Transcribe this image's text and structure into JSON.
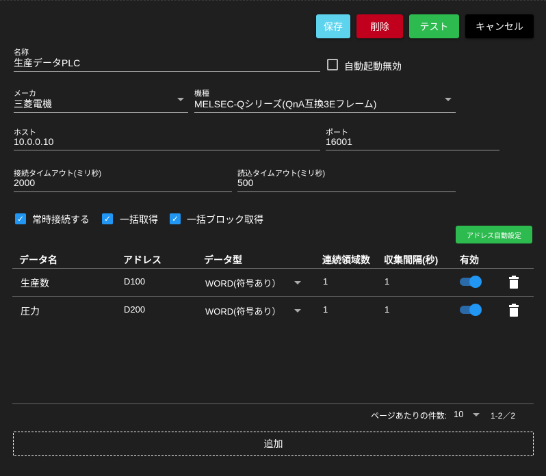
{
  "buttons": {
    "save": "保存",
    "delete": "削除",
    "test": "テスト",
    "cancel": "キャンセル"
  },
  "form": {
    "name": {
      "label": "名称",
      "value": "生産データPLC"
    },
    "auto_start_disabled": {
      "label": "自動起動無効",
      "checked": false
    },
    "maker": {
      "label": "メーカ",
      "value": "三菱電機"
    },
    "model": {
      "label": "機種",
      "value": "MELSEC-Qシリーズ(QnA互換3Eフレーム)"
    },
    "host": {
      "label": "ホスト",
      "value": "10.0.0.10"
    },
    "port": {
      "label": "ポート",
      "value": "16001"
    },
    "connect_timeout": {
      "label": "接続タイムアウト(ミリ秒)",
      "value": "2000"
    },
    "read_timeout": {
      "label": "読込タイムアウト(ミリ秒)",
      "value": "500"
    },
    "options": [
      {
        "label": "常時接続する",
        "checked": true
      },
      {
        "label": "一括取得",
        "checked": true
      },
      {
        "label": "一括ブロック取得",
        "checked": true
      }
    ]
  },
  "auto_address_button": "アドレス自動設定",
  "table": {
    "headers": [
      "データ名",
      "アドレス",
      "データ型",
      "連続領域数",
      "収集間隔(秒)",
      "有効"
    ],
    "rows": [
      {
        "name": "生産数",
        "address": "D100",
        "type": "WORD(符号あり）",
        "count": "1",
        "interval": "1",
        "enabled": true
      },
      {
        "name": "圧力",
        "address": "D200",
        "type": "WORD(符号あり）",
        "count": "1",
        "interval": "1",
        "enabled": true
      }
    ]
  },
  "pagination": {
    "per_page_label": "ページあたりの件数:",
    "per_page": "10",
    "range": "1-2／2"
  },
  "add_button": "追加",
  "colors": {
    "save": "#5ed3ee",
    "delete": "#c0001c",
    "test": "#2dba4e",
    "cancel": "#000000",
    "accent": "#2196f3"
  }
}
